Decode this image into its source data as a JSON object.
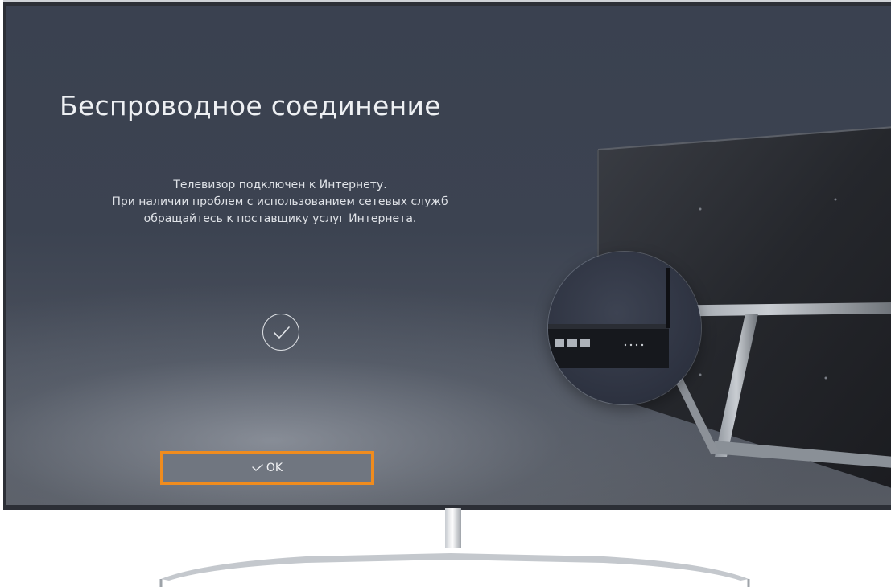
{
  "screen": {
    "title": "Беспроводное соединение",
    "message_lines": [
      "Телевизор подключен к Интернету.",
      "При наличии проблем с использованием сетевых служб",
      "обращайтесь к поставщику услуг Интернета."
    ],
    "status_icon": "checkmark-circle-icon",
    "ok_button": {
      "label": "OK",
      "icon": "checkmark-icon",
      "focused": true,
      "focus_color": "#f08c1e"
    }
  },
  "colors": {
    "screen_bg": "#3c4351",
    "button_bg": "#707680",
    "text": "#eef0f3"
  }
}
